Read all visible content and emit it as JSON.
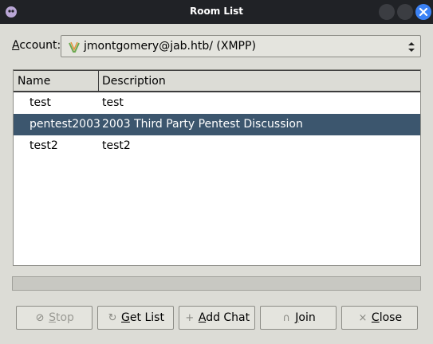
{
  "window": {
    "title": "Room List"
  },
  "account": {
    "label_prefix": "",
    "label_underlined": "A",
    "label_rest": "ccount:",
    "value": "jmontgomery@jab.htb/ (XMPP)"
  },
  "table": {
    "headers": {
      "name": "Name",
      "description": "Description"
    },
    "rows": [
      {
        "name": "test",
        "description": "test"
      },
      {
        "name": "pentest2003",
        "description": "2003 Third Party Pentest Discussion"
      },
      {
        "name": "test2",
        "description": "test2"
      }
    ]
  },
  "buttons": {
    "stop": {
      "u": "S",
      "rest": "top"
    },
    "get_list": {
      "u": "G",
      "rest": "et List"
    },
    "add_chat": {
      "u": "A",
      "rest": "dd Chat"
    },
    "join": {
      "u": "J",
      "rest": "oin"
    },
    "close": {
      "u": "C",
      "rest": "lose"
    }
  },
  "colors": {
    "selected_row": "#3c566e",
    "titlebar": "#202226",
    "close_button": "#3b82f6"
  }
}
